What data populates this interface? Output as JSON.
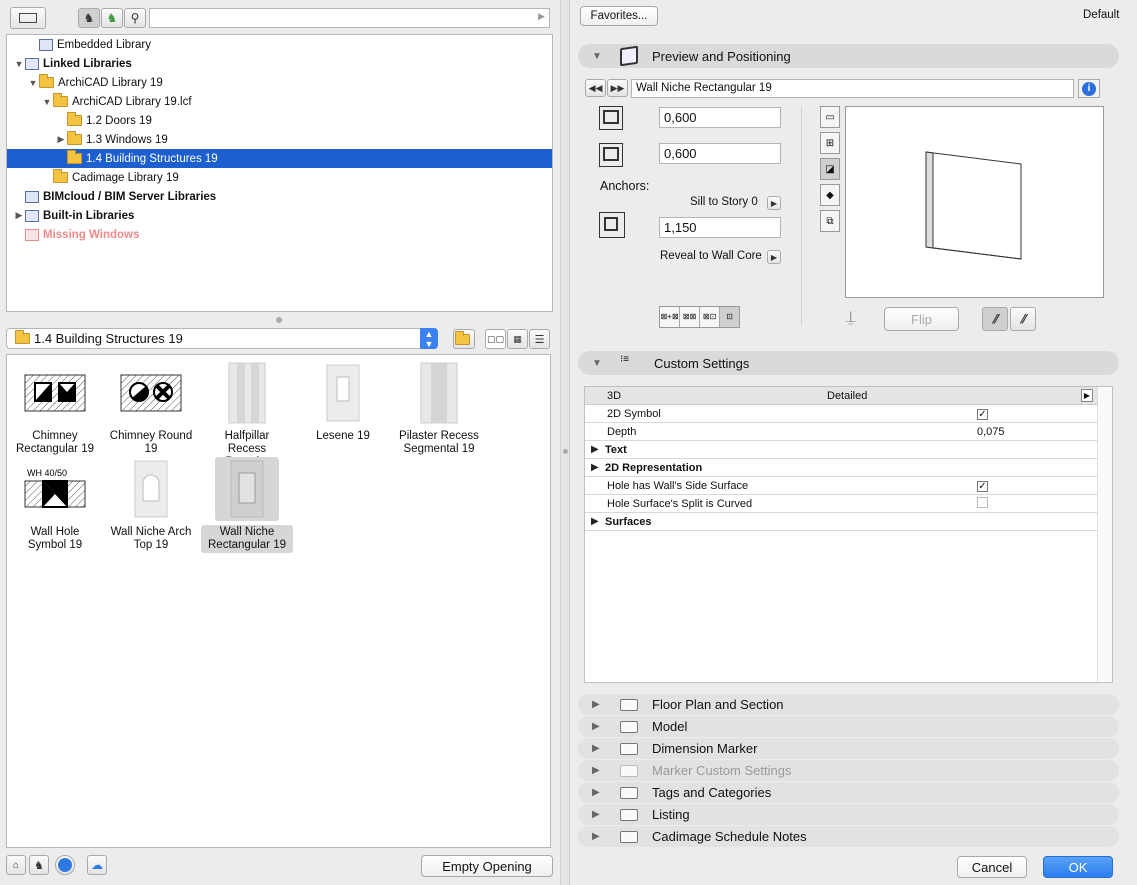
{
  "left": {
    "tree": [
      {
        "label": "Embedded Library",
        "level": 1,
        "arrow": "",
        "icon": "lib",
        "bold": false
      },
      {
        "label": "Linked Libraries",
        "level": 0,
        "arrow": "▼",
        "icon": "lib",
        "bold": true
      },
      {
        "label": "ArchiCAD Library 19",
        "level": 1,
        "arrow": "▼",
        "icon": "folder",
        "bold": false
      },
      {
        "label": "ArchiCAD Library 19.lcf",
        "level": 2,
        "arrow": "▼",
        "icon": "folder",
        "bold": false
      },
      {
        "label": "1.2 Doors 19",
        "level": 3,
        "arrow": "",
        "icon": "folder",
        "bold": false
      },
      {
        "label": "1.3 Windows 19",
        "level": 3,
        "arrow": "▶",
        "icon": "folder",
        "bold": false
      },
      {
        "label": "1.4 Building Structures 19",
        "level": 3,
        "arrow": "",
        "icon": "folder",
        "bold": false,
        "selected": true
      },
      {
        "label": "Cadimage Library 19",
        "level": 2,
        "arrow": "",
        "icon": "folder",
        "bold": false
      },
      {
        "label": "BIMcloud / BIM Server Libraries",
        "level": 0,
        "arrow": "",
        "icon": "lib",
        "bold": true
      },
      {
        "label": "Built-in Libraries",
        "level": 0,
        "arrow": "▶",
        "icon": "lib",
        "bold": true
      },
      {
        "label": "Missing Windows",
        "level": 0,
        "arrow": "",
        "icon": "missing",
        "bold": true,
        "missing": true
      }
    ],
    "folder_select": "1.4 Building Structures 19",
    "objects": [
      {
        "label": "Chimney Rectangular 19",
        "thumb": "chimney-rect",
        "selected": false
      },
      {
        "label": "Chimney Round 19",
        "thumb": "chimney-round",
        "selected": false
      },
      {
        "label": "Halfpillar Recess Round...",
        "thumb": "halfpillar",
        "selected": false
      },
      {
        "label": "Lesene 19",
        "thumb": "lesene",
        "selected": false
      },
      {
        "label": "Pilaster Recess Segmental 19",
        "thumb": "pilaster",
        "selected": false
      },
      {
        "label": "Wall Hole Symbol 19",
        "thumb": "wall-hole",
        "selected": false
      },
      {
        "label": "Wall Niche Arch Top 19",
        "thumb": "niche-arch",
        "selected": false
      },
      {
        "label": "Wall Niche Rectangular 19",
        "thumb": "niche-rect",
        "selected": true
      }
    ],
    "wall_hole_tag": "WH 40/50",
    "empty_opening_label": "Empty Opening"
  },
  "right": {
    "favorites_label": "Favorites...",
    "default_label": "Default",
    "preview": {
      "title": "Preview and Positioning",
      "object_name": "Wall Niche Rectangular 19",
      "width": "0,600",
      "height": "0,600",
      "anchors_label": "Anchors:",
      "sill_label": "Sill to Story 0",
      "sill_value": "1,150",
      "reveal_label": "Reveal to Wall Core",
      "flip_label": "Flip"
    },
    "custom": {
      "title": "Custom Settings",
      "header": {
        "name": "3D",
        "value": "Detailed"
      },
      "rows": [
        {
          "name": "2D Symbol",
          "value": "",
          "check": true,
          "group": false
        },
        {
          "name": "Depth",
          "value": "0,075",
          "check": null,
          "group": false
        },
        {
          "name": "Text",
          "value": "",
          "check": null,
          "group": true
        },
        {
          "name": "2D Representation",
          "value": "",
          "check": null,
          "group": true
        },
        {
          "name": "Hole has Wall's Side Surface",
          "value": "",
          "check": true,
          "group": false
        },
        {
          "name": "Hole Surface's Split is Curved",
          "value": "",
          "check": false,
          "group": false
        },
        {
          "name": "Surfaces",
          "value": "",
          "check": null,
          "group": true
        }
      ]
    },
    "sections": [
      {
        "label": "Floor Plan and Section",
        "disabled": false
      },
      {
        "label": "Model",
        "disabled": false
      },
      {
        "label": "Dimension Marker",
        "disabled": false
      },
      {
        "label": "Marker Custom Settings",
        "disabled": true
      },
      {
        "label": "Tags and Categories",
        "disabled": false
      },
      {
        "label": "Listing",
        "disabled": false
      },
      {
        "label": "Cadimage Schedule Notes",
        "disabled": false
      }
    ],
    "cancel_label": "Cancel",
    "ok_label": "OK"
  },
  "colors": {
    "selection": "#1d5fcf",
    "ok": "#2a7ef0",
    "missing": "#f08a8a"
  }
}
